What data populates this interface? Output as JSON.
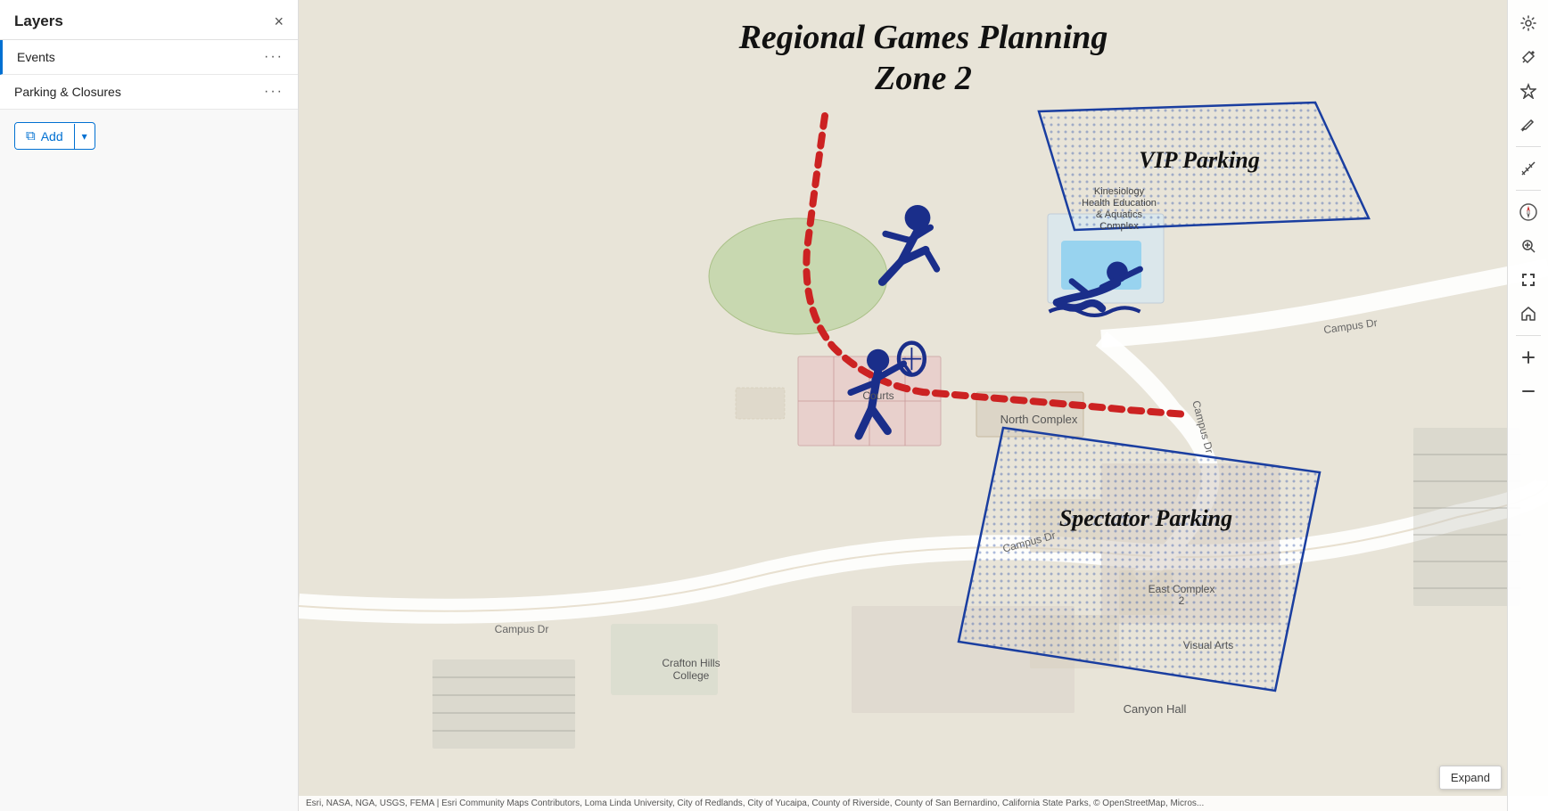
{
  "sidebar": {
    "title": "Layers",
    "close_icon": "×",
    "layers": [
      {
        "id": "events",
        "label": "Events",
        "active": true
      },
      {
        "id": "parking-closures",
        "label": "Parking & Closures",
        "active": false
      }
    ],
    "add_button": {
      "label": "Add",
      "icon": "layers-icon"
    }
  },
  "map": {
    "title_line1": "Regional Games Planning",
    "title_line2": "Zone 2",
    "vip_parking_label": "VIP Parking",
    "spectator_parking_label": "Spectator Parking",
    "kinesiology_label": "Kinesiology\nHealth Education\n& Aquatics\nComplex",
    "north_complex_label": "North Complex",
    "courts_label": "Courts",
    "east_complex_label": "East Complex\n2",
    "visual_arts_label": "Visual Arts",
    "canyon_hall_label": "Canyon Hall",
    "campus_dr_label": "Campus Dr",
    "crafton_hills_label": "Crafton Hills\nCollege",
    "campus_dr_label2": "Campus Dr"
  },
  "attribution": {
    "text": "Esri, NASA, NGA, USGS, FEMA | Esri Community Maps Contributors, Loma Linda University, City of Redlands, City of Yucaipa, County of Riverside, County of San Bernardino, California State Parks, © OpenStreetMap, Micros..."
  },
  "toolbar": {
    "buttons": [
      {
        "id": "settings",
        "icon": "⚙",
        "label": "settings-icon"
      },
      {
        "id": "tools",
        "icon": "✦",
        "label": "tools-icon"
      },
      {
        "id": "star",
        "icon": "★",
        "label": "star-icon"
      },
      {
        "id": "pencil",
        "icon": "✏",
        "label": "pencil-icon"
      },
      {
        "id": "measure",
        "icon": "📐",
        "label": "measure-icon"
      },
      {
        "id": "compass",
        "icon": "◎",
        "label": "compass-icon"
      },
      {
        "id": "zoom-in",
        "icon": "🔍",
        "label": "zoom-in-icon"
      },
      {
        "id": "fullscreen",
        "icon": "⛶",
        "label": "fullscreen-icon"
      },
      {
        "id": "home",
        "icon": "⌂",
        "label": "home-icon"
      },
      {
        "id": "plus",
        "icon": "+",
        "label": "zoom-plus-icon"
      },
      {
        "id": "minus",
        "icon": "−",
        "label": "zoom-minus-icon"
      }
    ],
    "expand_label": "Expand"
  }
}
